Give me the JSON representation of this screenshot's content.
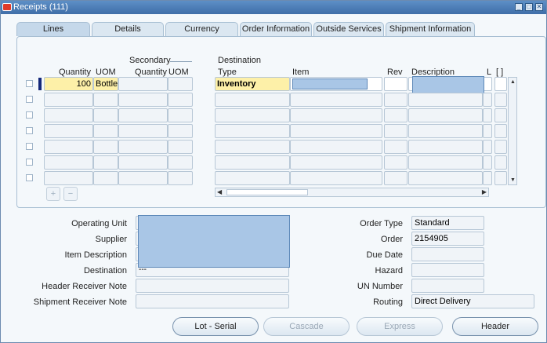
{
  "window": {
    "title": "Receipts (111)"
  },
  "tabs": [
    "Lines",
    "Details",
    "Currency",
    "Order Information",
    "Outside Services",
    "Shipment Information"
  ],
  "columns": {
    "quantity": "Quantity",
    "uom": "UOM",
    "secondary": "Secondary",
    "sec_quantity": "Quantity",
    "sec_uom": "UOM",
    "destination": "Destination",
    "dest_type": "Type",
    "item": "Item",
    "rev": "Rev",
    "description": "Description",
    "l": "L",
    "bracket": "[ ]"
  },
  "row1": {
    "quantity": "100",
    "uom": "Bottle",
    "dest_type": "Inventory"
  },
  "form": {
    "operating_unit_label": "Operating Unit",
    "supplier_label": "Supplier",
    "item_description_label": "Item Description",
    "destination_label": "Destination",
    "destination_value": "---",
    "header_receiver_note_label": "Header Receiver Note",
    "shipment_receiver_note_label": "Shipment Receiver Note",
    "order_type_label": "Order Type",
    "order_type_value": "Standard",
    "order_label": "Order",
    "order_value": "2154905",
    "due_date_label": "Due Date",
    "hazard_label": "Hazard",
    "un_number_label": "UN Number",
    "routing_label": "Routing",
    "routing_value": "Direct Delivery"
  },
  "buttons": {
    "lot_serial": "Lot - Serial",
    "cascade": "Cascade",
    "express": "Express",
    "header": "Header"
  },
  "row_icons": {
    "add": "+",
    "remove": "−"
  }
}
